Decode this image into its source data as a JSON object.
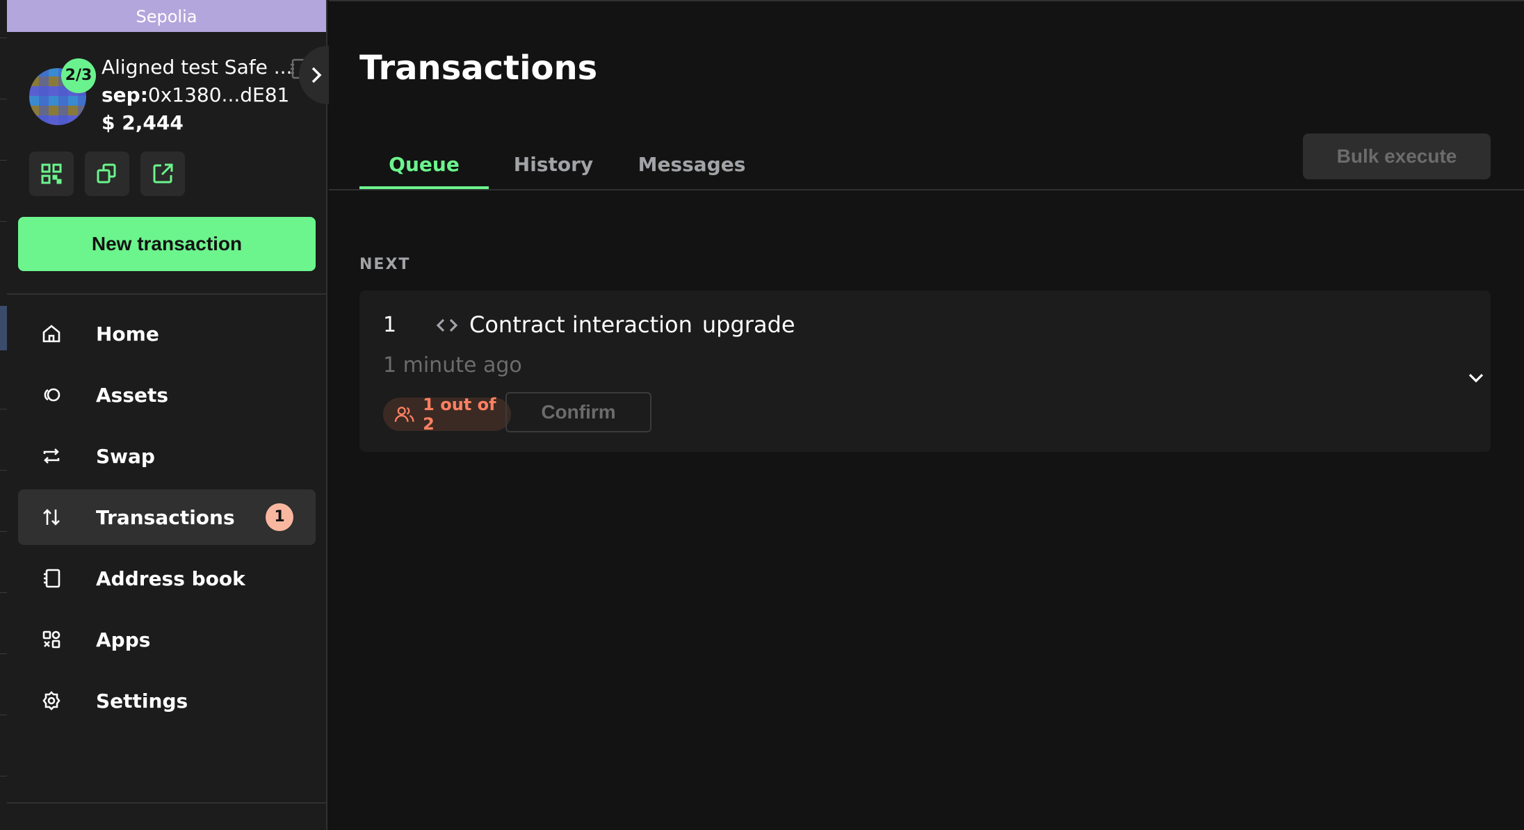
{
  "network": {
    "name": "Sepolia"
  },
  "safe": {
    "threshold": "2/3",
    "name": "Aligned test Safe ...",
    "address_prefix": "sep:",
    "address": "0x1380...dE81",
    "balance": "$ 2,444"
  },
  "sidebar": {
    "new_transaction_label": "New transaction",
    "items": [
      {
        "label": "Home",
        "icon": "home-icon"
      },
      {
        "label": "Assets",
        "icon": "assets-icon"
      },
      {
        "label": "Swap",
        "icon": "swap-icon"
      },
      {
        "label": "Transactions",
        "icon": "transactions-icon",
        "badge": "1",
        "active": true
      },
      {
        "label": "Address book",
        "icon": "address-book-icon"
      },
      {
        "label": "Apps",
        "icon": "apps-icon"
      },
      {
        "label": "Settings",
        "icon": "settings-icon"
      }
    ]
  },
  "main": {
    "title": "Transactions",
    "tabs": [
      {
        "label": "Queue",
        "active": true
      },
      {
        "label": "History"
      },
      {
        "label": "Messages"
      }
    ],
    "bulk_execute_label": "Bulk execute",
    "section_label": "NEXT",
    "transaction": {
      "nonce": "1",
      "type": "Contract interaction",
      "method": "upgrade",
      "time": "1 minute ago",
      "signatures": "1 out of 2",
      "confirm_label": "Confirm"
    }
  },
  "colors": {
    "accent": "#6cf48d",
    "network": "#b3a6dc",
    "warning": "#ff8061",
    "badge": "#f9b7a0"
  }
}
